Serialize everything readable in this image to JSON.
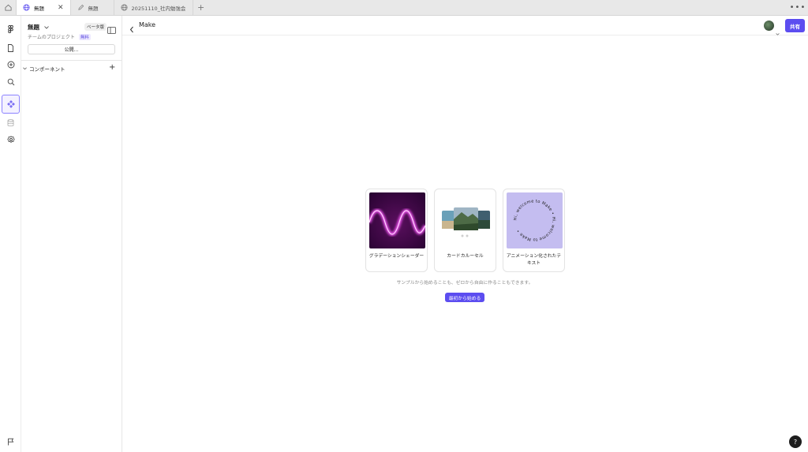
{
  "tabs": [
    {
      "label": "無題",
      "icon": "globe-icon",
      "active": true
    },
    {
      "label": "無題",
      "icon": "pencil-icon",
      "active": false
    },
    {
      "label": "20251110_社内勉強会",
      "icon": "globe-icon",
      "active": false
    }
  ],
  "tab_close": "✕",
  "tab_add": "+",
  "tab_menu": "•••",
  "side": {
    "file_name": "無題",
    "beta_label": "ベータ版",
    "team_label": "チームのプロジェクト",
    "free_badge": "無料",
    "publish_label": "公開...",
    "components_label": "コンポーネント",
    "components_add": "+"
  },
  "header": {
    "title": "Make",
    "share_label": "共有"
  },
  "cards": [
    {
      "label": "グラデーションシェーダー"
    },
    {
      "label": "カードカルーセル"
    },
    {
      "label": "アニメーション化されたテキスト",
      "ring_text": "Hi, welcome to Make • Hi, welcome to Make •"
    }
  ],
  "hint": "サンプルから始めることも、ゼロから自由に作ることもできます。",
  "start_label": "最初から始める",
  "help_label": "?",
  "colors": {
    "accent": "#5c4df0",
    "selected_rail": "#8c82ff",
    "lavender": "#c4bdf0"
  }
}
